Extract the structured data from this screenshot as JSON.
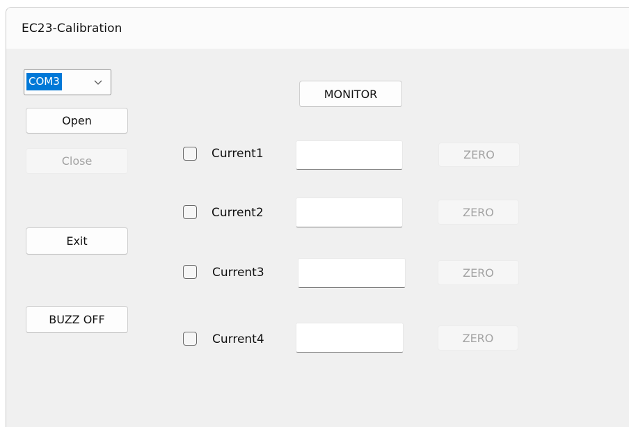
{
  "window": {
    "title": "EC23-Calibration"
  },
  "port": {
    "selected": "COM3",
    "chevron_icon": "chevron-down-icon"
  },
  "buttons": {
    "open": "Open",
    "close": "Close",
    "exit": "Exit",
    "buzz_off": "BUZZ OFF",
    "monitor": "MONITOR"
  },
  "channels": [
    {
      "label": "Current1",
      "value": "",
      "checked": false,
      "zero_label": "ZERO"
    },
    {
      "label": "Current2",
      "value": "",
      "checked": false,
      "zero_label": "ZERO"
    },
    {
      "label": "Current3",
      "value": "",
      "checked": false,
      "zero_label": "ZERO"
    },
    {
      "label": "Current4",
      "value": "",
      "checked": false,
      "zero_label": "ZERO"
    }
  ],
  "colors": {
    "selection": "#0078d7",
    "window_bg": "#f0f0f0",
    "disabled_text": "#a3a3a3"
  }
}
